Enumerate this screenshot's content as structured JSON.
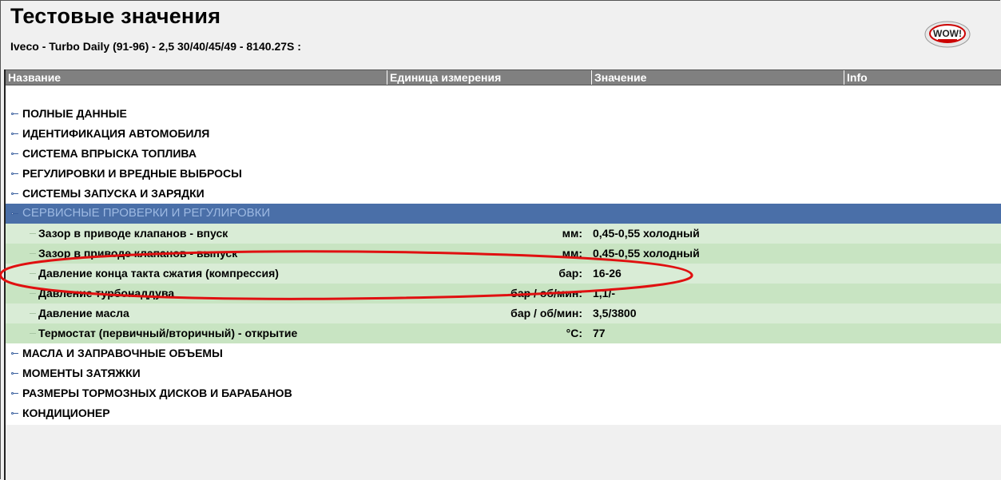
{
  "page": {
    "title": "Тестовые значения",
    "subtitle": "Iveco - Turbo Daily (91-96) - 2,5 30/40/45/49 - 8140.27S :",
    "logo_text": "WOW!"
  },
  "columns": {
    "name": "Название",
    "unit": "Единица измерения",
    "value": "Значение",
    "info": "Info"
  },
  "groups_before": [
    {
      "label": "ПОЛНЫЕ ДАННЫЕ"
    },
    {
      "label": "ИДЕНТИФИКАЦИЯ АВТОМОБИЛЯ"
    },
    {
      "label": "СИСТЕМА ВПРЫСКА ТОПЛИВА"
    },
    {
      "label": "РЕГУЛИРОВКИ И ВРЕДНЫЕ ВЫБРОСЫ"
    },
    {
      "label": "СИСТЕМЫ ЗАПУСКА И ЗАРЯДКИ"
    }
  ],
  "selected_group": {
    "label": "СЕРВИСНЫЕ ПРОВЕРКИ И РЕГУЛИРОВКИ",
    "items": [
      {
        "name": "Зазор в приводе клапанов - впуск",
        "unit": "мм:",
        "value": "0,45-0,55  холодный"
      },
      {
        "name": "Зазор в приводе клапанов - выпуск",
        "unit": "мм:",
        "value": "0,45-0,55  холодный"
      },
      {
        "name": "Давление конца такта сжатия (компрессия)",
        "unit": "бар:",
        "value": "16-26"
      },
      {
        "name": "Давление турбонаддува",
        "unit": "бар / об/мин:",
        "value": "1,1/-"
      },
      {
        "name": "Давление масла",
        "unit": "бар / об/мин:",
        "value": "3,5/3800"
      },
      {
        "name": "Термостат (первичный/вторичный) - открытие",
        "unit": "°C:",
        "value": "77"
      }
    ]
  },
  "groups_after": [
    {
      "label": "МАСЛА И ЗАПРАВОЧНЫЕ ОБЪЕМЫ"
    },
    {
      "label": "МОМЕНТЫ ЗАТЯЖКИ"
    },
    {
      "label": "РАЗМЕРЫ ТОРМОЗНЫХ ДИСКОВ И БАРАБАНОВ"
    },
    {
      "label": "КОНДИЦИОНЕР"
    }
  ],
  "colors": {
    "header_bg": "#808080",
    "selected_bg": "#4a6fa8",
    "row_light": "#d9ecd6",
    "row_dark": "#c8e4c2",
    "annotation": "#e01010"
  }
}
